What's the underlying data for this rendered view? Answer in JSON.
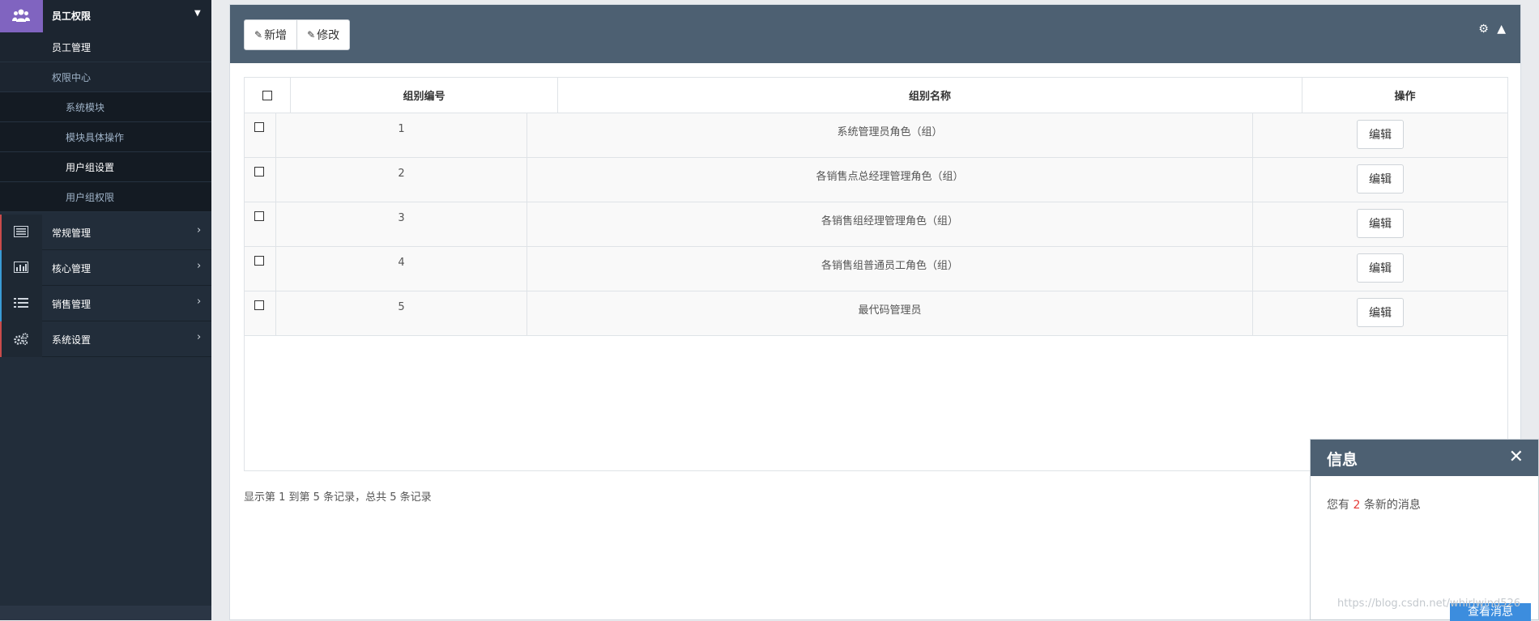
{
  "sidebar": {
    "top_label": "员工权限",
    "sub_items": [
      {
        "label": "员工管理"
      },
      {
        "label": "权限中心"
      },
      {
        "label": "系统模块"
      },
      {
        "label": "模块具体操作"
      },
      {
        "label": "用户组设置"
      },
      {
        "label": "用户组权限"
      }
    ],
    "nav_items": [
      {
        "label": "常规管理",
        "icon": "list-alt-icon",
        "accent": "#c94b4b"
      },
      {
        "label": "核心管理",
        "icon": "bar-chart-icon",
        "accent": "#3a9bd5"
      },
      {
        "label": "销售管理",
        "icon": "list-icon",
        "accent": "#3a9bd5"
      },
      {
        "label": "系统设置",
        "icon": "cogs-icon",
        "accent": "#c94b4b"
      }
    ]
  },
  "toolbar": {
    "add_label": "新增",
    "edit_label": "修改"
  },
  "table": {
    "headers": [
      "组别编号",
      "组别名称",
      "操作"
    ],
    "rows": [
      {
        "id": "1",
        "name": "系统管理员角色（组）",
        "action": "编辑"
      },
      {
        "id": "2",
        "name": "各销售点总经理管理角色（组）",
        "action": "编辑"
      },
      {
        "id": "3",
        "name": "各销售组经理管理角色（组）",
        "action": "编辑"
      },
      {
        "id": "4",
        "name": "各销售组普通员工角色（组）",
        "action": "编辑"
      },
      {
        "id": "5",
        "name": "最代码管理员",
        "action": "编辑"
      }
    ]
  },
  "pagination": {
    "summary": "显示第 1 到第 5 条记录，总共 5 条记录"
  },
  "notification": {
    "title": "信息",
    "msg_prefix": "您有 ",
    "count": "2",
    "msg_suffix": " 条新的消息",
    "button": "查看消息"
  },
  "watermark": "https://blog.csdn.net/whirlwind526",
  "colors": {
    "sidebar_bg": "#222d3a",
    "header_bg": "#4d6072",
    "accent_purple": "#8064c0",
    "notify_button": "#3c8dde",
    "count_red": "#e53935"
  }
}
